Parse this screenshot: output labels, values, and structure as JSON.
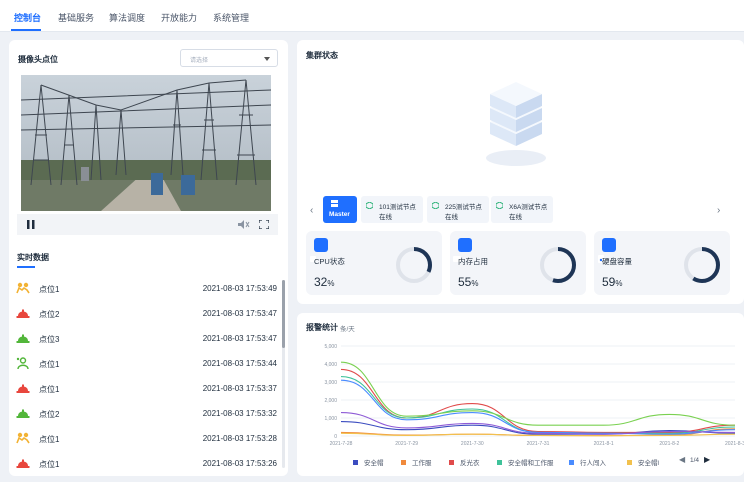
{
  "nav": {
    "items": [
      "控制台",
      "基础服务",
      "算法调度",
      "开放能力",
      "系统管理"
    ]
  },
  "camera": {
    "title": "摄像头点位",
    "select_placeholder": "请选择"
  },
  "realtime": {
    "tab": "实时数据",
    "rows": [
      {
        "name": "点位1",
        "time": "2021-08-03 17:53:49",
        "icon": "worker-alert-icon"
      },
      {
        "name": "点位2",
        "time": "2021-08-03 17:53:47",
        "icon": "red-helmet-icon"
      },
      {
        "name": "点位3",
        "time": "2021-08-03 17:53:47",
        "icon": "green-helmet-icon"
      },
      {
        "name": "点位1",
        "time": "2021-08-03 17:53:44",
        "icon": "green-worker-icon"
      },
      {
        "name": "点位1",
        "time": "2021-08-03 17:53:37",
        "icon": "red-helmet-icon"
      },
      {
        "name": "点位2",
        "time": "2021-08-03 17:53:32",
        "icon": "green-helmet-icon"
      },
      {
        "name": "点位1",
        "time": "2021-08-03 17:53:28",
        "icon": "worker-alert-icon"
      },
      {
        "name": "点位1",
        "time": "2021-08-03 17:53:26",
        "icon": "red-helmet-icon"
      }
    ]
  },
  "cluster": {
    "title": "集群状态",
    "nodes": [
      {
        "name": "Master",
        "status": ""
      },
      {
        "name": "101测试节点",
        "status": "在线"
      },
      {
        "name": "225测试节点",
        "status": "在线"
      },
      {
        "name": "X6A测试节点",
        "status": "在线"
      }
    ],
    "metrics": [
      {
        "label": "CPU状态",
        "value": "32",
        "unit": "%",
        "percent": 32
      },
      {
        "label": "内存占用",
        "value": "55",
        "unit": "%",
        "percent": 55
      },
      {
        "label": "硬盘容量",
        "value": "59",
        "unit": "%",
        "percent": 59
      }
    ]
  },
  "alarm": {
    "title": "报警统计",
    "unit": "条/天",
    "pager": "1/4"
  },
  "colors": {
    "accent": "#1f6fff",
    "ring": "#1e3556",
    "ring_track": "#dfe3ea"
  },
  "chart_data": {
    "type": "line",
    "categories": [
      "2021-7-28",
      "2021-7-29",
      "2021-7-30",
      "2021-7-31",
      "2021-8-1",
      "2021-8-2",
      "2021-8-3"
    ],
    "ylim": [
      0,
      5000
    ],
    "yticks": [
      "5,000",
      "4,000",
      "3,000",
      "2,000",
      "1,000",
      "0"
    ],
    "legend": [
      "安全帽",
      "工作服",
      "反光衣",
      "安全帽和工作服",
      "行人闯入",
      "安全帽l"
    ],
    "legend_position": "bottom",
    "series": [
      {
        "name": "安全帽",
        "color": "#3b4cc0",
        "values": [
          800,
          350,
          600,
          100,
          100,
          300,
          150
        ]
      },
      {
        "name": "工作服",
        "color": "#f08a3c",
        "values": [
          200,
          50,
          100,
          30,
          20,
          50,
          400
        ]
      },
      {
        "name": "反光衣",
        "color": "#e04b4b",
        "values": [
          3700,
          1000,
          1800,
          250,
          200,
          200,
          600
        ]
      },
      {
        "name": "安全帽和工作服",
        "color": "#3fc29a",
        "values": [
          3300,
          1000,
          1500,
          200,
          150,
          150,
          500
        ]
      },
      {
        "name": "行人闯入",
        "color": "#4a8cff",
        "values": [
          3100,
          900,
          1300,
          200,
          150,
          100,
          350
        ]
      },
      {
        "name": "安全帽l",
        "color": "#f2c14e",
        "values": [
          150,
          30,
          100,
          30,
          20,
          30,
          100
        ]
      },
      {
        "name": "",
        "color": "#7ad151",
        "values": [
          4100,
          1100,
          1400,
          600,
          600,
          1200,
          600
        ]
      },
      {
        "name": "",
        "color": "#8e5bd6",
        "values": [
          1300,
          450,
          700,
          150,
          100,
          250,
          200
        ]
      }
    ]
  }
}
